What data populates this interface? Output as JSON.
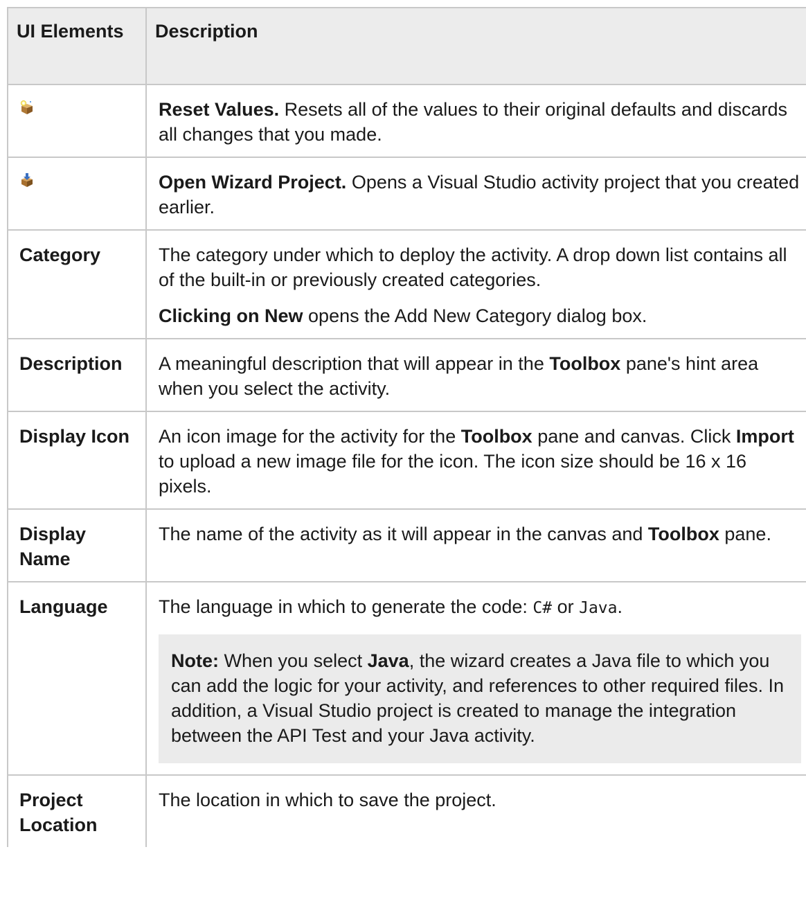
{
  "table": {
    "header": {
      "col1": "UI Elements",
      "col2": "Description"
    },
    "rows": [
      {
        "icon": "reset-values-icon",
        "title": "Reset Values.",
        "text": " Resets all of the values to their original defaults and discards all changes that you made."
      },
      {
        "icon": "open-wizard-project-icon",
        "title": "Open Wizard Project.",
        "text": " Opens a Visual Studio activity project that you created earlier."
      },
      {
        "label": "Category",
        "text": "The category under which to deploy the activity. A drop down list contains all of the built-in or previously created categories.",
        "p2_bold": "Clicking on New",
        "p2_text": " opens the Add New Category dialog box."
      },
      {
        "label": "Description",
        "t1": "A meaningful description that will appear in the ",
        "b1": "Toolbox",
        "t2": " pane's hint area when you select the activity."
      },
      {
        "label": "Display Icon",
        "t1": "An icon image for the activity for the ",
        "b1": "Toolbox",
        "t2": " pane and canvas. Click ",
        "b2": "Import",
        "t3": " to upload a new image file for the icon. The icon size should be 16 x 16 pixels."
      },
      {
        "label": "Display Name",
        "t1": "The name of the activity as it will appear in the canvas and ",
        "b1": "Toolbox",
        "t2": " pane."
      },
      {
        "label": "Language",
        "t1": "The language in which to generate the code: ",
        "code1": "C#",
        "t2": " or ",
        "code2": "Java",
        "t3": ".",
        "note": {
          "label": "Note:",
          "t1": " When you select ",
          "b1": "Java",
          "t2": ", the wizard creates a Java file to which you can add the logic for your activity, and references to other required files. In addition, a Visual Studio project is created to manage the integration between the API Test and your Java activity."
        }
      },
      {
        "label": "Project Location",
        "text": "The location in which to save the project."
      }
    ]
  },
  "colors": {
    "header_bg": "#ececec",
    "border": "#c8c8c8",
    "note_bg": "#ebebeb"
  }
}
